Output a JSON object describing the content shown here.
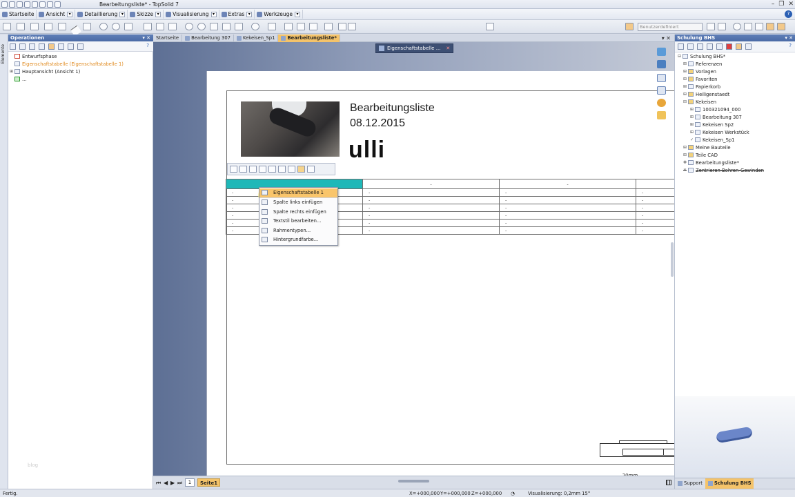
{
  "window": {
    "title": "Bearbeitungsliste* - TopSolid 7"
  },
  "menubar": {
    "items": [
      {
        "label": "Startseite",
        "icon": "home-icon"
      },
      {
        "label": "Ansicht",
        "icon": "view-icon"
      },
      {
        "label": "Detaillierung",
        "icon": "detail-icon"
      },
      {
        "label": "Skizze",
        "icon": "sketch-icon"
      },
      {
        "label": "Visualisierung",
        "icon": "visualization-icon"
      },
      {
        "label": "Extras",
        "icon": "tools-icon"
      },
      {
        "label": "Werkzeuge",
        "icon": "wrench-icon"
      }
    ]
  },
  "toolbar": {
    "style_placeholder": "Benutzerdefiniert"
  },
  "left_panel": {
    "side_label": "Elemente",
    "title": "Operationen",
    "tree": [
      {
        "label": "Entwurfsphase",
        "style": "normal"
      },
      {
        "label": "Eigenschaftstabelle (Eigenschaftstabelle 1)",
        "style": "orange"
      },
      {
        "label": "Hauptansicht (Ansicht 1)",
        "style": "normal"
      },
      {
        "label": "...",
        "style": "normal"
      }
    ],
    "watermark": "blog"
  },
  "tabs": [
    {
      "label": "Startseite"
    },
    {
      "label": "Bearbeitung 307"
    },
    {
      "label": "Kekeisen_Sp1"
    },
    {
      "label": "Bearbeitungsliste*"
    }
  ],
  "floating_tab": {
    "label": "Eigenschaftstabelle ..."
  },
  "sheet": {
    "title": "Bearbeitungsliste",
    "date": "08.12.2015",
    "user": "ulli",
    "table": {
      "header": [
        "",
        "-",
        "-",
        ""
      ],
      "rows": [
        [
          "-",
          "-",
          "-",
          "-"
        ],
        [
          "-",
          "-",
          "-",
          "-"
        ],
        [
          "-",
          "-",
          "-",
          "-"
        ],
        [
          "-",
          "-",
          "-",
          "-"
        ],
        [
          "-",
          "-",
          "-",
          "-"
        ],
        [
          "-",
          "-",
          "-",
          "-"
        ]
      ]
    },
    "scale_label": "20mm"
  },
  "context_menu": {
    "items": [
      {
        "label": "Eigenschaftstabelle 1",
        "highlight": true
      },
      {
        "label": "Spalte links einfügen"
      },
      {
        "label": "Spalte rechts einfügen"
      },
      {
        "label": "Textstil bearbeiten..."
      },
      {
        "label": "Rahmentypen..."
      },
      {
        "label": "Hintergrundfarbe..."
      }
    ]
  },
  "page_nav": {
    "page_number": "1",
    "page_tab": "Seite1"
  },
  "right_panel": {
    "title": "Schulung BHS",
    "tree": [
      {
        "label": "Schulung BHS*",
        "indent": 0
      },
      {
        "label": "Referenzen",
        "indent": 1
      },
      {
        "label": "Vorlagen",
        "indent": 1
      },
      {
        "label": "Favoriten",
        "indent": 1
      },
      {
        "label": "Papierkorb",
        "indent": 1
      },
      {
        "label": "Heiligenstaedt",
        "indent": 1
      },
      {
        "label": "Kekeisen",
        "indent": 1
      },
      {
        "label": "100321094_000",
        "indent": 2
      },
      {
        "label": "Bearbeitung 307",
        "indent": 2
      },
      {
        "label": "Kekeisen Sp2",
        "indent": 2
      },
      {
        "label": "Kekeisen Werkstück",
        "indent": 2
      },
      {
        "label": "Kekeisen_Sp1",
        "indent": 2
      },
      {
        "label": "Meine Bauteile",
        "indent": 1
      },
      {
        "label": "Teile CAD",
        "indent": 1
      },
      {
        "label": "Bearbeitungsliste*",
        "indent": 1
      },
      {
        "label": "Zentrieren-Bohren-Gewinden",
        "indent": 1,
        "strike": true
      }
    ],
    "bottom_tabs": [
      {
        "label": "Support"
      },
      {
        "label": "Schulung BHS"
      }
    ]
  },
  "status": {
    "left": "Fertig.",
    "x": "X=+000,000",
    "y": "Y=+000,000",
    "z": "Z=+000,000",
    "vis": "Visualisierung: 0,2mm 15°"
  },
  "colors": {
    "accent": "#f4c36a",
    "panel_header": "#4a6aa5",
    "table_header": "#1fb8b8",
    "tree_highlight": "#e08a1e"
  }
}
